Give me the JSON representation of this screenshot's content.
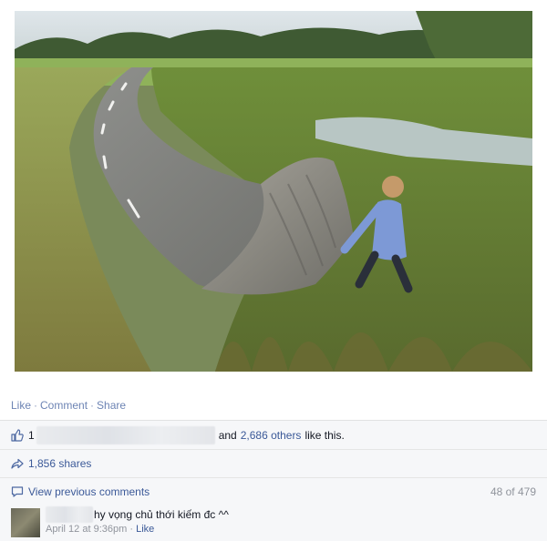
{
  "post": {
    "actions": {
      "like": "Like",
      "sep": "·",
      "comment": "Comment",
      "share": "Share"
    }
  },
  "likes": {
    "icon": "thumbs-up-icon",
    "prefix": "1",
    "and_text": "and",
    "others_link": "2,686 others",
    "suffix": "like this."
  },
  "shares": {
    "icon": "share-arrow-icon",
    "label": "1,856 shares"
  },
  "comments": {
    "icon": "speech-bubble-icon",
    "view_previous": "View previous comments",
    "count": "48 of 479",
    "items": [
      {
        "text": "hy vọng chủ thới kiếm đc ^^",
        "time": "April 12 at 9:36pm",
        "sep": "·",
        "like": "Like"
      }
    ]
  },
  "colors": {
    "link": "#3b5998",
    "muted": "#90949c",
    "panel": "#f6f7f9"
  }
}
